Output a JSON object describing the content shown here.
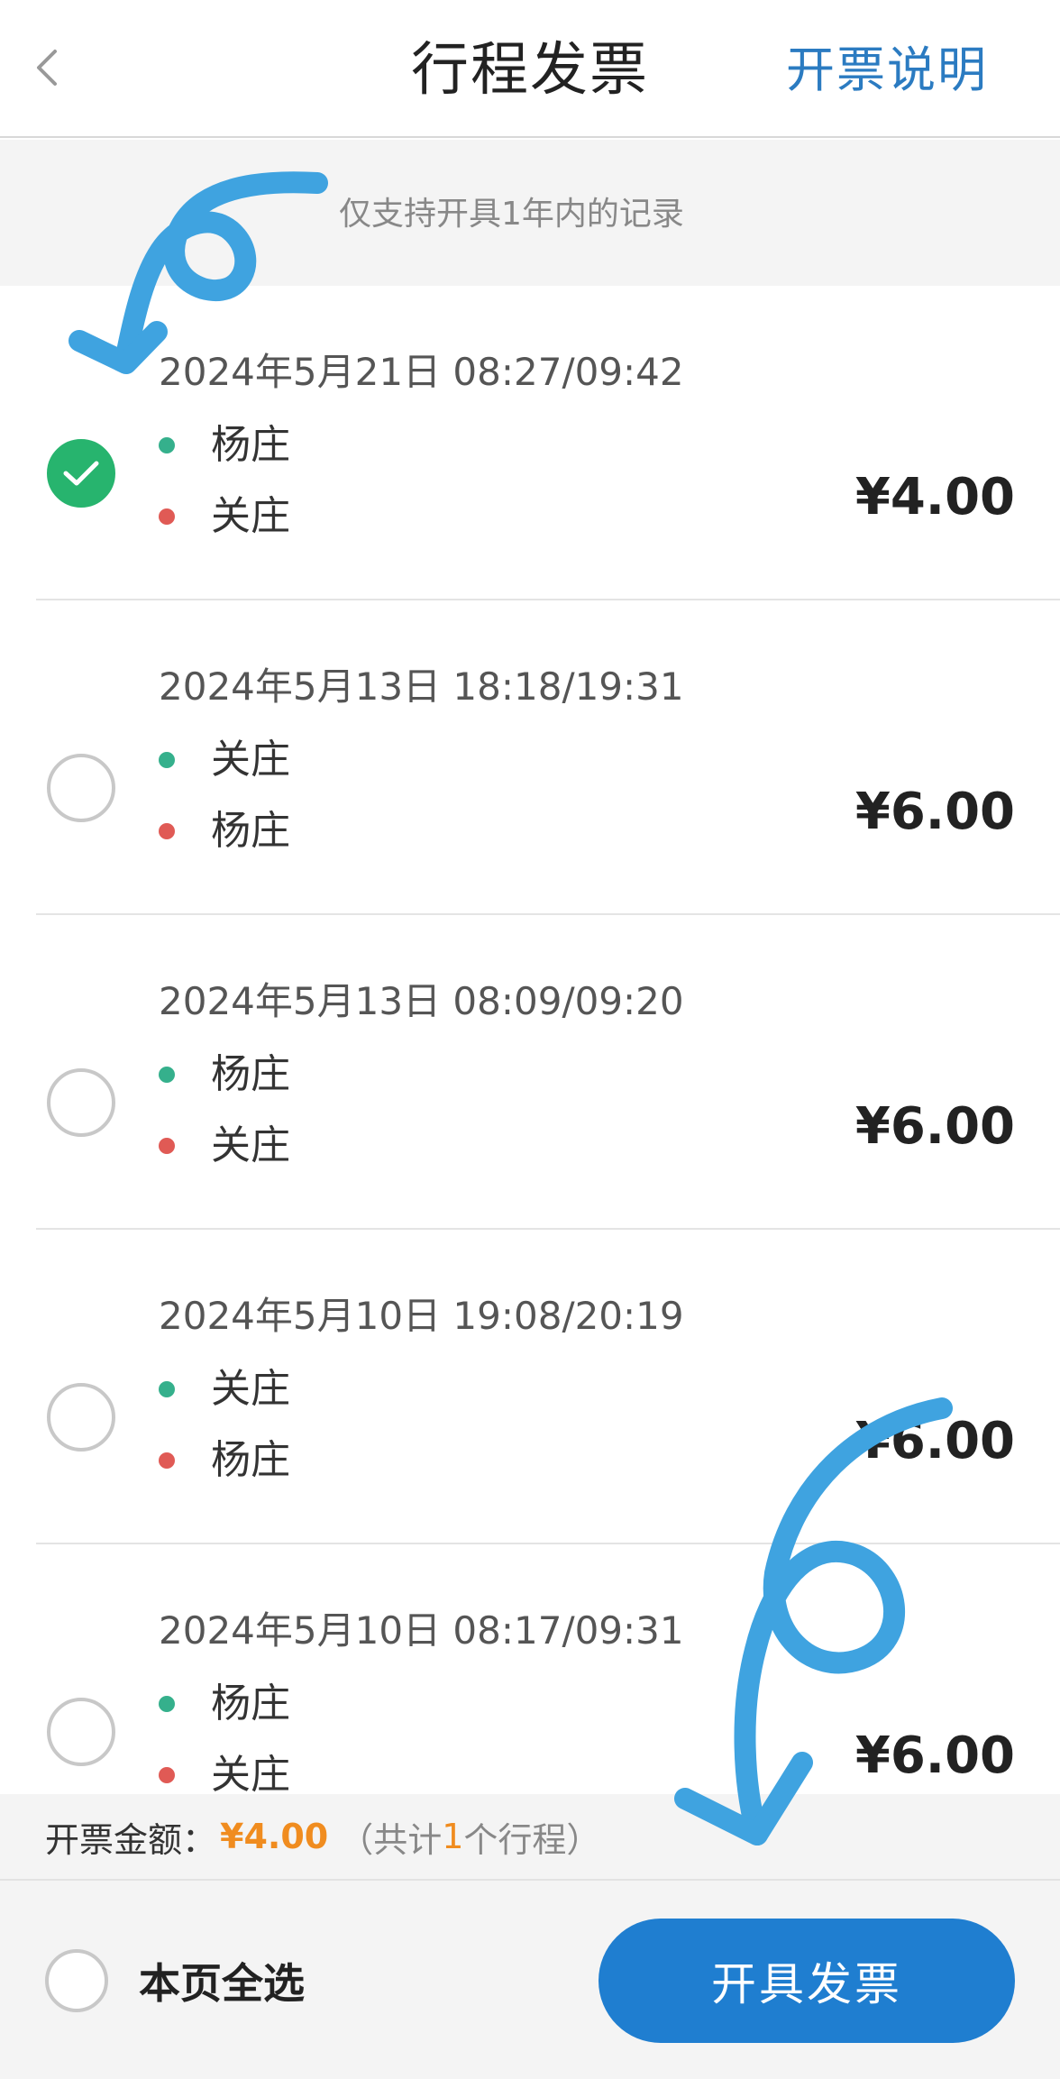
{
  "header": {
    "back_icon": "chevron-left-icon",
    "title": "行程发票",
    "help_link": "开票说明",
    "help_color": "#2b7bc1"
  },
  "notice": {
    "text": "仅支持开具1年内的记录"
  },
  "trips": [
    {
      "time": "2024年5月21日 08:27/09:42",
      "from": "杨庄",
      "to": "关庄",
      "price": "¥4.00",
      "selected": true
    },
    {
      "time": "2024年5月13日 18:18/19:31",
      "from": "关庄",
      "to": "杨庄",
      "price": "¥6.00",
      "selected": false
    },
    {
      "time": "2024年5月13日 08:09/09:20",
      "from": "杨庄",
      "to": "关庄",
      "price": "¥6.00",
      "selected": false
    },
    {
      "time": "2024年5月10日 19:08/20:19",
      "from": "关庄",
      "to": "杨庄",
      "price": "¥6.00",
      "selected": false
    },
    {
      "time": "2024年5月10日 08:17/09:31",
      "from": "杨庄",
      "to": "关庄",
      "price": "¥6.00",
      "selected": false
    }
  ],
  "summary": {
    "label": "开票金额：",
    "amount": "¥4.00",
    "count_prefix": "（共计",
    "count": "1",
    "count_suffix": "个行程）"
  },
  "footer": {
    "select_all_label": "本页全选",
    "issue_button": "开具发票",
    "button_color": "#1f7ed0"
  },
  "colors": {
    "selected_green": "#27b46e",
    "origin_dot": "#35b08c",
    "destination_dot": "#e05a55",
    "amount_orange": "#f08c1f",
    "annotation_blue": "#3fa3e0"
  }
}
